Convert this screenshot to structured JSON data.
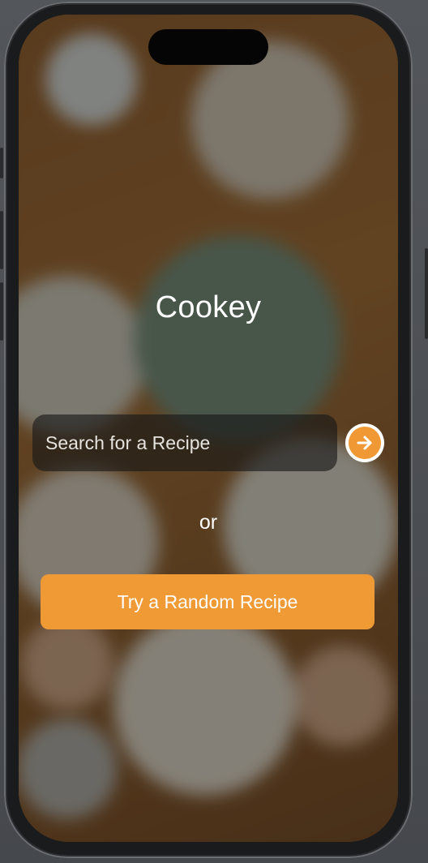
{
  "app": {
    "title": "Cookey"
  },
  "search": {
    "placeholder": "Search for a Recipe",
    "value": "",
    "submit_icon": "arrow-right-circle-icon"
  },
  "divider_text": "or",
  "random_button": {
    "label": "Try a Random Recipe"
  },
  "colors": {
    "accent": "#f09a36",
    "text": "#ffffff",
    "input_background": "#161616"
  }
}
